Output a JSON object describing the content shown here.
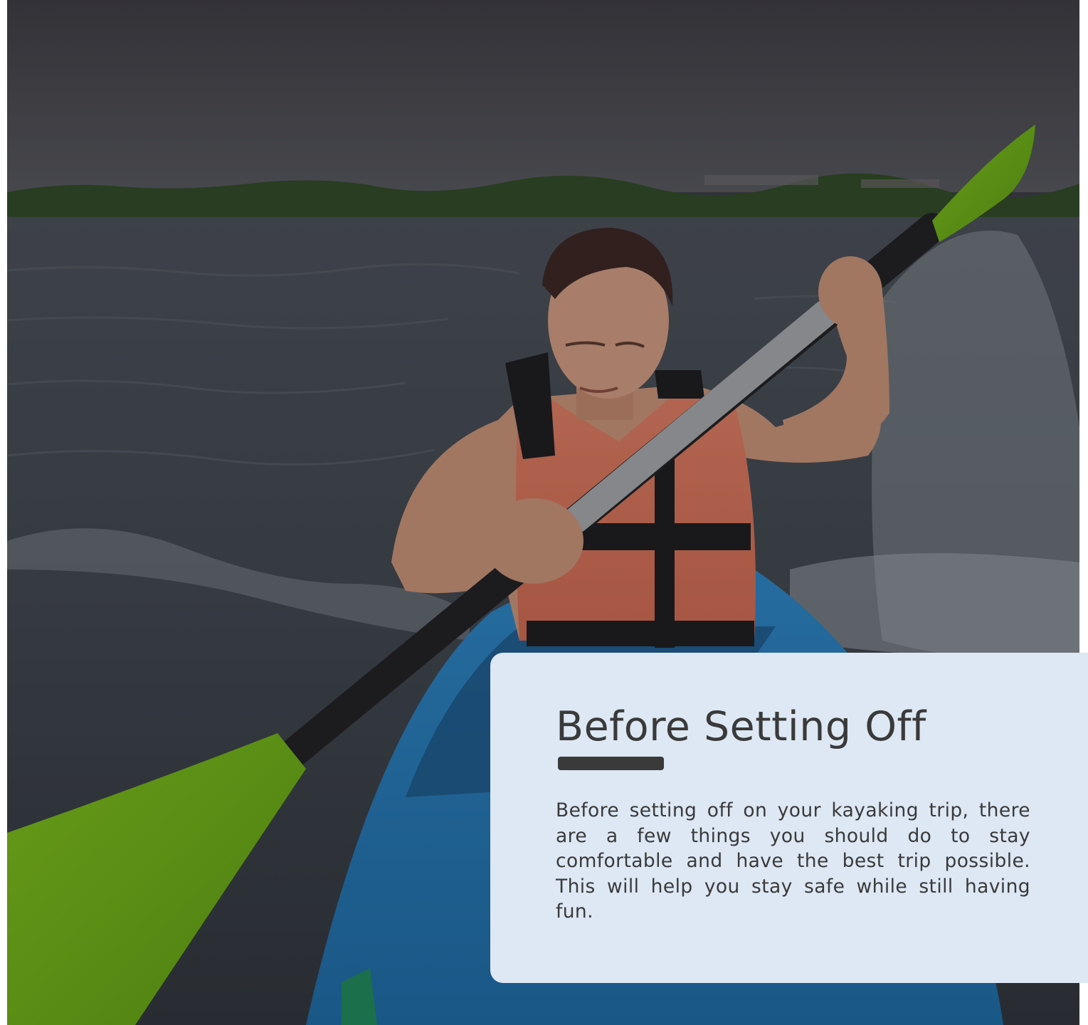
{
  "hero": {
    "image": "kayaker-paddling-on-lake-photo"
  },
  "card": {
    "title": "Before Setting Off",
    "body": "Before setting off on your kayaking trip, there are a few things you should do to stay comfortable and have the best trip possible. This will help you stay safe while still having fun."
  },
  "colors": {
    "card_background": "#dde8f4",
    "text": "#3a3a3a",
    "rule": "#3a3a3a"
  }
}
